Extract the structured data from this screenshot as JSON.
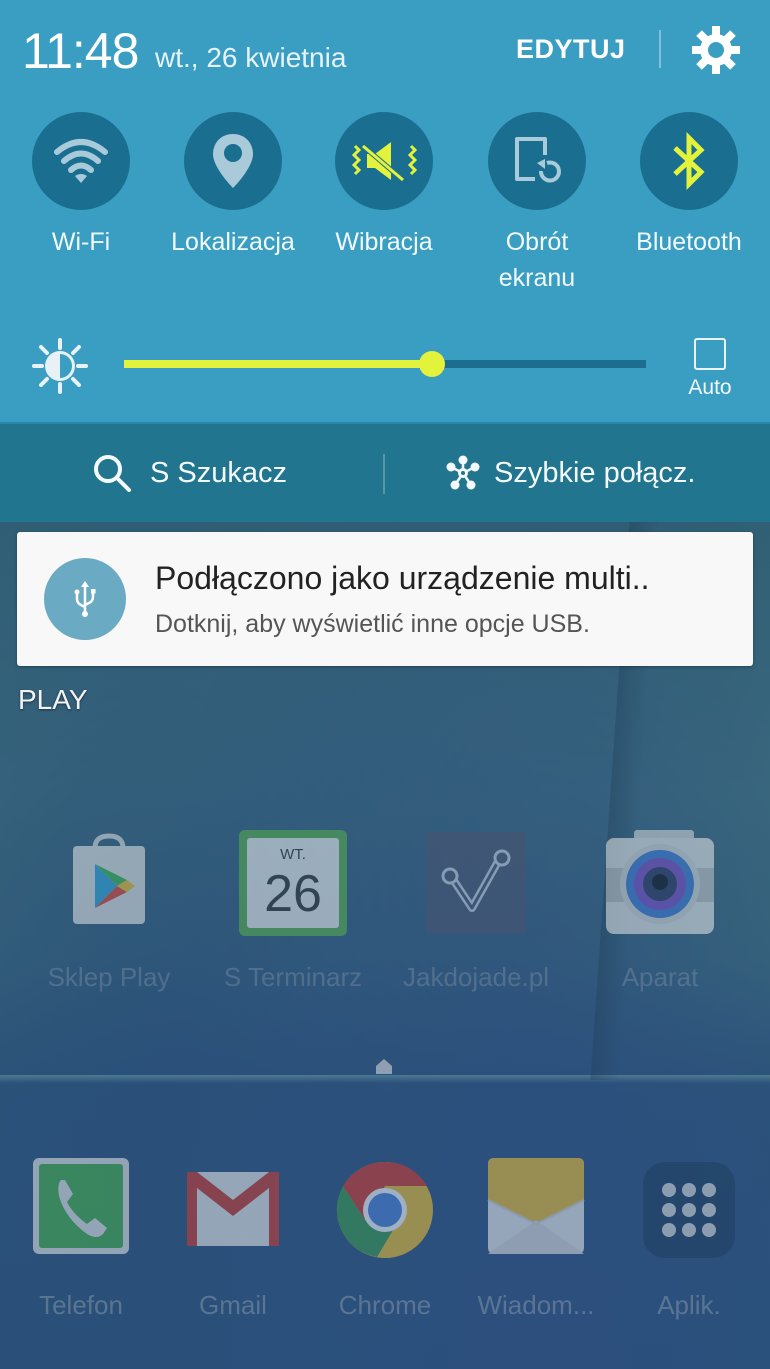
{
  "header": {
    "time": "11:48",
    "date": "wt., 26 kwietnia",
    "edit_label": "EDYTUJ",
    "settings_icon": "gear-icon"
  },
  "quick_toggles": [
    {
      "id": "wifi",
      "label": "Wi-Fi",
      "icon": "wifi-icon",
      "active": false
    },
    {
      "id": "location",
      "label": "Lokalizacja",
      "icon": "location-pin-icon",
      "active": false
    },
    {
      "id": "vibration",
      "label": "Wibracja",
      "icon": "vibrate-mute-icon",
      "active": true
    },
    {
      "id": "rotation",
      "label_line1": "Obrót",
      "label_line2": "ekranu",
      "icon": "screen-rotation-icon",
      "active": false
    },
    {
      "id": "bluetooth",
      "label": "Bluetooth",
      "icon": "bluetooth-icon",
      "active": true
    }
  ],
  "brightness": {
    "level": 0.59,
    "auto_label": "Auto",
    "auto_checked": false,
    "icon": "brightness-icon"
  },
  "quickbar": {
    "search_label": "S Szukacz",
    "quick_connect_label": "Szybkie połącz."
  },
  "notification": {
    "title": "Podłączono jako urządzenie multi..",
    "text": "Dotknij, aby wyświetlić inne opcje USB.",
    "icon": "usb-icon"
  },
  "home": {
    "folder_label": "PLAY",
    "apps": [
      {
        "label": "Sklep Play",
        "icon": "play-store-icon"
      },
      {
        "label": "S Terminarz",
        "icon": "calendar-icon",
        "day_abbr": "WT.",
        "day": "26"
      },
      {
        "label": "Jakdojade.pl",
        "icon": "jakdojade-icon"
      },
      {
        "label": "Aparat",
        "icon": "camera-icon"
      }
    ],
    "dock": [
      {
        "label": "Telefon",
        "icon": "phone-icon"
      },
      {
        "label": "Gmail",
        "icon": "gmail-icon"
      },
      {
        "label": "Chrome",
        "icon": "chrome-icon"
      },
      {
        "label": "Wiadom...",
        "icon": "messages-icon"
      },
      {
        "label": "Aplik.",
        "icon": "apps-grid-icon"
      }
    ]
  },
  "colors": {
    "panel_bg": "#3a9ec2",
    "toggle_circle": "#1a6f91",
    "active_accent": "#e3f23a",
    "quickbar_bg": "#22758f"
  }
}
